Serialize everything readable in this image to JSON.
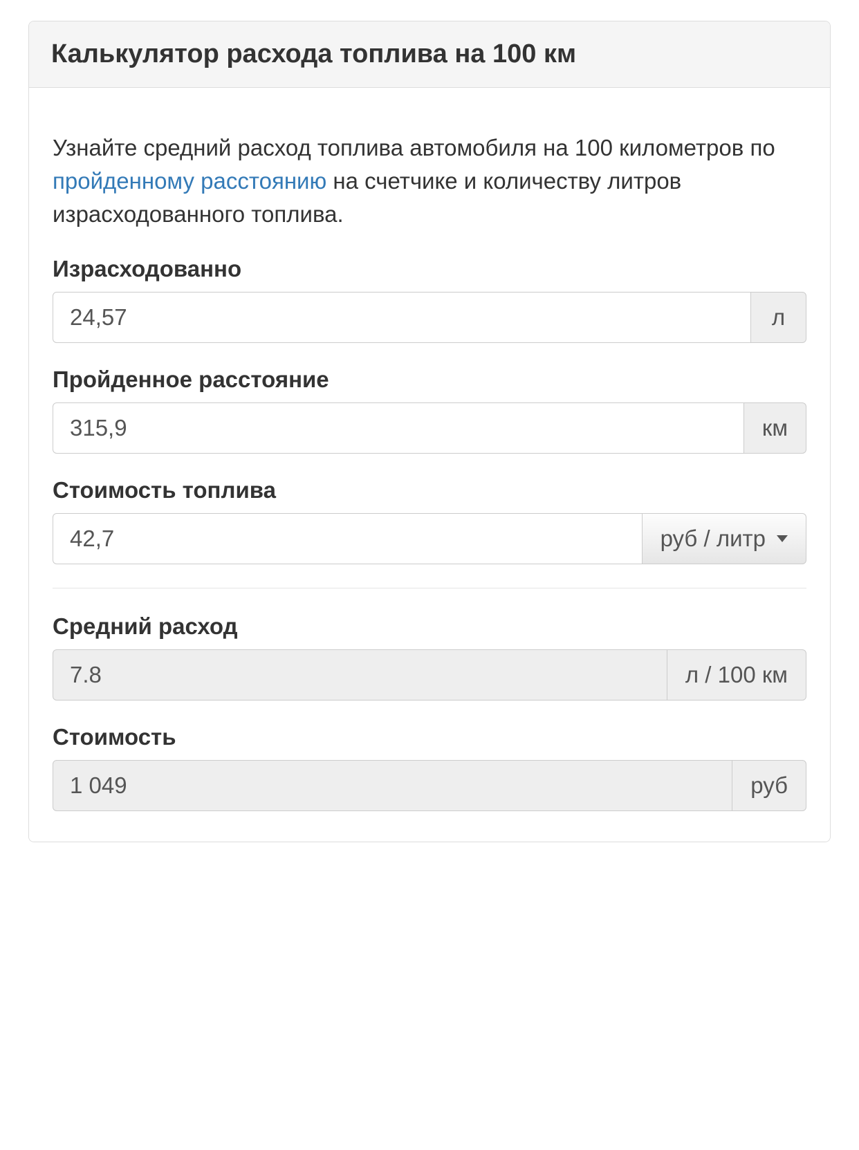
{
  "panel": {
    "title": "Калькулятор расхода топлива на 100 км"
  },
  "intro": {
    "before_link": "Узнайте средний расход топлива автомобиля на 100 километров по ",
    "link_text": "пройденному расстоянию",
    "after_link": " на счетчике и количеству литров израсходованного топлива."
  },
  "fields": {
    "consumed": {
      "label": "Израсходованно",
      "value": "24,57",
      "unit": "л"
    },
    "distance": {
      "label": "Пройденное расстояние",
      "value": "315,9",
      "unit": "км"
    },
    "price": {
      "label": "Стоимость топлива",
      "value": "42,7",
      "unit_button": "руб / литр"
    },
    "avg": {
      "label": "Средний расход",
      "value": "7.8",
      "unit": "л / 100 км"
    },
    "cost": {
      "label": "Стоимость",
      "value": "1 049",
      "unit": "руб"
    }
  }
}
